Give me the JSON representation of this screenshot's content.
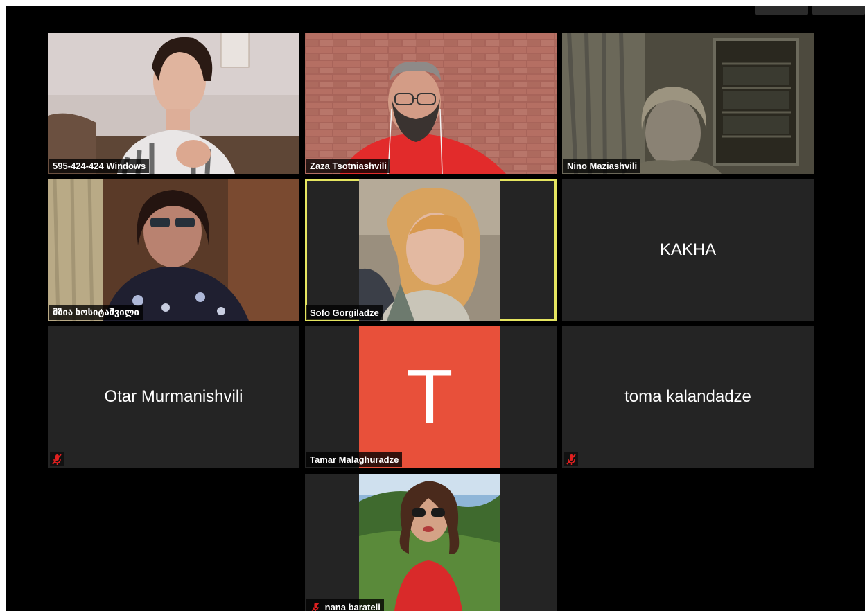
{
  "window": {
    "controls": [
      "",
      ""
    ]
  },
  "participants": [
    {
      "id": "p1",
      "name": "595-424-424 Windows",
      "video": "on"
    },
    {
      "id": "p2",
      "name": "Zaza Tsotniashvili",
      "video": "on"
    },
    {
      "id": "p3",
      "name": "Nino Maziashvili",
      "video": "on"
    },
    {
      "id": "p4",
      "name": "მზია ხოსიტაშვილი",
      "video": "on"
    },
    {
      "id": "p5",
      "name": "Sofo Gorgiladze",
      "video": "profile-photo",
      "active_speaker": true
    },
    {
      "id": "p6",
      "name": "KAKHA",
      "video": "off"
    },
    {
      "id": "p7",
      "name": "Otar Murmanishvili",
      "video": "off",
      "muted": true
    },
    {
      "id": "p8",
      "name": "Tamar Malaghuradze",
      "video": "avatar",
      "avatar_letter": "T",
      "avatar_color": "#e8503a"
    },
    {
      "id": "p9",
      "name": "toma kalandadze",
      "video": "off",
      "muted": true
    },
    {
      "id": "p10",
      "name": "nana barateli",
      "video": "profile-photo",
      "muted": true
    }
  ],
  "colors": {
    "active_speaker_border": "#e5e560",
    "tile_background": "#242424",
    "muted_icon": "#e02020"
  },
  "icons": {
    "muted": "microphone-muted-icon"
  }
}
